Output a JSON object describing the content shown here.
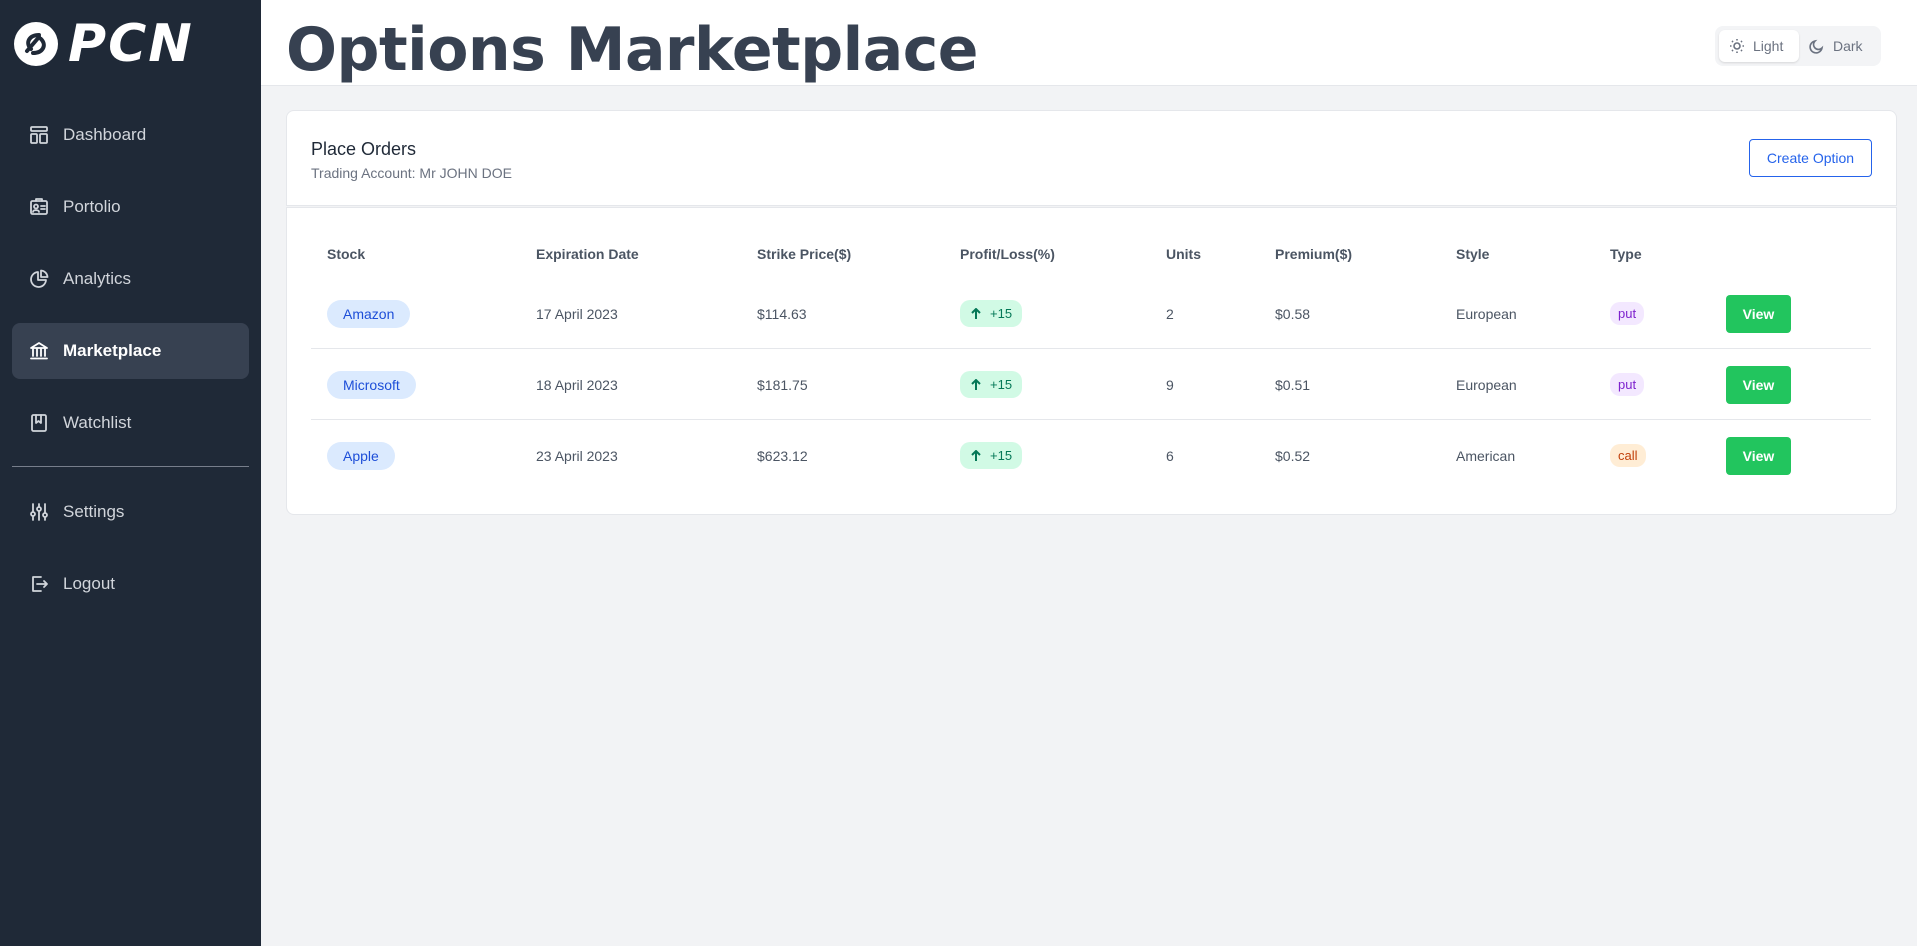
{
  "brand": {
    "logo_text": "PCN"
  },
  "sidebar": {
    "items": [
      {
        "label": "Dashboard",
        "icon": "layout-icon"
      },
      {
        "label": "Portolio",
        "icon": "portfolio-icon"
      },
      {
        "label": "Analytics",
        "icon": "pie-chart-icon"
      },
      {
        "label": "Marketplace",
        "icon": "bank-icon",
        "active": true
      },
      {
        "label": "Watchlist",
        "icon": "bookmark-icon"
      }
    ],
    "bottom_items": [
      {
        "label": "Settings",
        "icon": "sliders-icon"
      },
      {
        "label": "Logout",
        "icon": "logout-icon"
      }
    ]
  },
  "header": {
    "title": "Options Marketplace",
    "theme": {
      "light_label": "Light",
      "dark_label": "Dark",
      "selected": "Light"
    }
  },
  "orders": {
    "title": "Place Orders",
    "subtitle": "Trading Account: Mr JOHN DOE",
    "create_label": "Create Option"
  },
  "table": {
    "columns": [
      "Stock",
      "Expiration Date",
      "Strike Price($)",
      "Profit/Loss(%)",
      "Units",
      "Premium($)",
      "Style",
      "Type"
    ],
    "rows": [
      {
        "stock": "Amazon",
        "expiration": "17 April 2023",
        "strike": "$114.63",
        "pl": "+15",
        "units": "2",
        "premium": "$0.58",
        "style": "European",
        "type": "put",
        "action": "View"
      },
      {
        "stock": "Microsoft",
        "expiration": "18 April 2023",
        "strike": "$181.75",
        "pl": "+15",
        "units": "9",
        "premium": "$0.51",
        "style": "European",
        "type": "put",
        "action": "View"
      },
      {
        "stock": "Apple",
        "expiration": "23 April 2023",
        "strike": "$623.12",
        "pl": "+15",
        "units": "6",
        "premium": "$0.52",
        "style": "American",
        "type": "call",
        "action": "View"
      }
    ]
  },
  "colors": {
    "sidebar_bg": "#1f2937",
    "accent_blue": "#2563eb",
    "view_green": "#22c55e",
    "put_badge": "#f3e8ff",
    "call_badge": "#ffedd5"
  }
}
